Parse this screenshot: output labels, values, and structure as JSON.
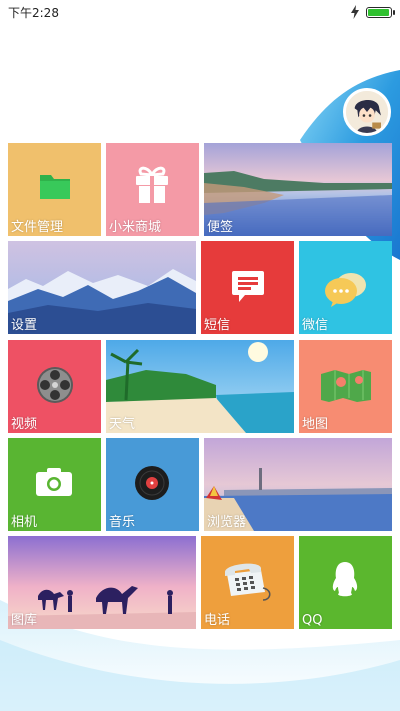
{
  "status_bar": {
    "time": "下午2:28",
    "battery_percent": 95
  },
  "tiles": {
    "files": {
      "label": "文件管理",
      "icon": "folder-icon",
      "color": "#f0c06c"
    },
    "mi_store": {
      "label": "小米商城",
      "icon": "gift-icon",
      "color": "#f49aa6"
    },
    "notes": {
      "label": "便签",
      "icon": "lake-photo"
    },
    "settings": {
      "label": "设置",
      "icon": "mountain-photo"
    },
    "sms": {
      "label": "短信",
      "icon": "message-icon",
      "color": "#e63b3b"
    },
    "wechat": {
      "label": "微信",
      "icon": "chat-bubbles-icon",
      "color": "#2fc3e3"
    },
    "video": {
      "label": "视频",
      "icon": "film-reel-icon",
      "color": "#ee5164"
    },
    "weather": {
      "label": "天气",
      "icon": "beach-photo"
    },
    "map": {
      "label": "地图",
      "icon": "map-icon",
      "color": "#f78c72"
    },
    "camera": {
      "label": "相机",
      "icon": "camera-icon",
      "color": "#59b532"
    },
    "music": {
      "label": "音乐",
      "icon": "vinyl-record-icon",
      "color": "#489ad7"
    },
    "browser": {
      "label": "浏览器",
      "icon": "harbor-photo"
    },
    "gallery": {
      "label": "图库",
      "icon": "desert-camel-photo"
    },
    "phone": {
      "label": "电话",
      "icon": "telephone-icon",
      "color": "#ee9f3d"
    },
    "qq": {
      "label": "QQ",
      "icon": "penguin-icon",
      "color": "#5bb72e"
    }
  }
}
